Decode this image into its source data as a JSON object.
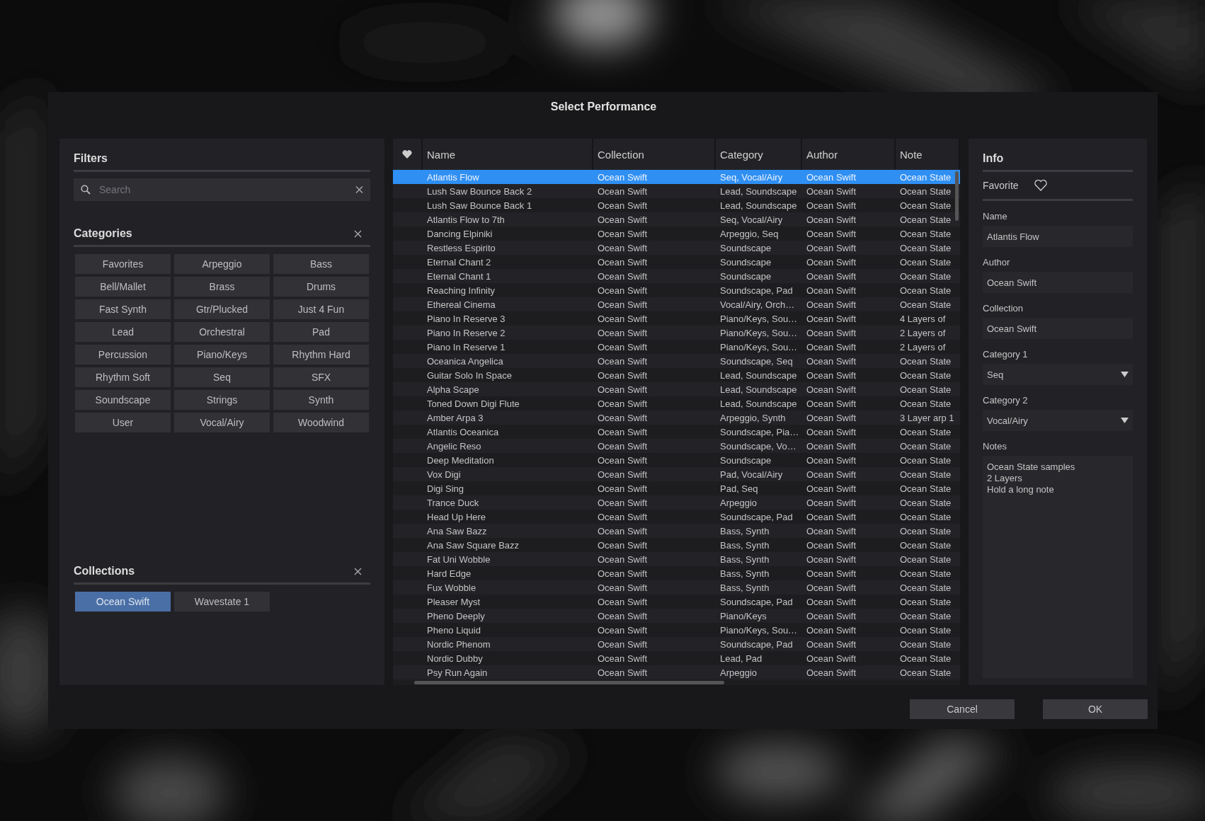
{
  "window": {
    "title": "Select Performance"
  },
  "filters": {
    "title": "Filters",
    "search": {
      "placeholder": "Search"
    }
  },
  "categories": {
    "title": "Categories",
    "items": [
      {
        "label": "Favorites",
        "selected": false
      },
      {
        "label": "Arpeggio",
        "selected": false
      },
      {
        "label": "Bass",
        "selected": false
      },
      {
        "label": "Bell/Mallet",
        "selected": false
      },
      {
        "label": "Brass",
        "selected": false
      },
      {
        "label": "Drums",
        "selected": false
      },
      {
        "label": "Fast Synth",
        "selected": false
      },
      {
        "label": "Gtr/Plucked",
        "selected": false
      },
      {
        "label": "Just 4 Fun",
        "selected": false
      },
      {
        "label": "Lead",
        "selected": false
      },
      {
        "label": "Orchestral",
        "selected": false
      },
      {
        "label": "Pad",
        "selected": false
      },
      {
        "label": "Percussion",
        "selected": false
      },
      {
        "label": "Piano/Keys",
        "selected": false
      },
      {
        "label": "Rhythm Hard",
        "selected": false
      },
      {
        "label": "Rhythm Soft",
        "selected": false
      },
      {
        "label": "Seq",
        "selected": false
      },
      {
        "label": "SFX",
        "selected": false
      },
      {
        "label": "Soundscape",
        "selected": false
      },
      {
        "label": "Strings",
        "selected": false
      },
      {
        "label": "Synth",
        "selected": false
      },
      {
        "label": "User",
        "selected": false
      },
      {
        "label": "Vocal/Airy",
        "selected": false
      },
      {
        "label": "Woodwind",
        "selected": false
      }
    ]
  },
  "collections": {
    "title": "Collections",
    "items": [
      {
        "label": "Ocean Swift",
        "selected": true
      },
      {
        "label": "Wavestate 1",
        "selected": false
      }
    ]
  },
  "table": {
    "columns": [
      "Name",
      "Collection",
      "Category",
      "Author",
      "Note"
    ],
    "rows": [
      {
        "name": "Atlantis Flow",
        "collection": "Ocean Swift",
        "category": "Seq, Vocal/Airy",
        "author": "Ocean Swift",
        "note": "Ocean State",
        "selected": true
      },
      {
        "name": "Lush Saw Bounce Back 2",
        "collection": "Ocean Swift",
        "category": "Lead, Soundscape",
        "author": "Ocean Swift",
        "note": "Ocean State",
        "selected": false
      },
      {
        "name": "Lush Saw Bounce Back 1",
        "collection": "Ocean Swift",
        "category": "Lead, Soundscape",
        "author": "Ocean Swift",
        "note": "Ocean State",
        "selected": false
      },
      {
        "name": "Atlantis Flow to 7th",
        "collection": "Ocean Swift",
        "category": "Seq, Vocal/Airy",
        "author": "Ocean Swift",
        "note": "Ocean State",
        "selected": false
      },
      {
        "name": "Dancing Elpiniki",
        "collection": "Ocean Swift",
        "category": "Arpeggio, Seq",
        "author": "Ocean Swift",
        "note": "Ocean State",
        "selected": false
      },
      {
        "name": "Restless Espirito",
        "collection": "Ocean Swift",
        "category": "Soundscape",
        "author": "Ocean Swift",
        "note": "Ocean State",
        "selected": false
      },
      {
        "name": "Eternal Chant 2",
        "collection": "Ocean Swift",
        "category": "Soundscape",
        "author": "Ocean Swift",
        "note": "Ocean State",
        "selected": false
      },
      {
        "name": "Eternal Chant 1",
        "collection": "Ocean Swift",
        "category": "Soundscape",
        "author": "Ocean Swift",
        "note": "Ocean State",
        "selected": false
      },
      {
        "name": "Reaching Infinity",
        "collection": "Ocean Swift",
        "category": "Soundscape, Pad",
        "author": "Ocean Swift",
        "note": "Ocean State",
        "selected": false
      },
      {
        "name": "Ethereal Cinema",
        "collection": "Ocean Swift",
        "category": "Vocal/Airy, Orch…",
        "author": "Ocean Swift",
        "note": "Ocean State",
        "selected": false
      },
      {
        "name": "Piano In Reserve 3",
        "collection": "Ocean Swift",
        "category": "Piano/Keys, Sou…",
        "author": "Ocean Swift",
        "note": "4 Layers of",
        "selected": false
      },
      {
        "name": "Piano In Reserve 2",
        "collection": "Ocean Swift",
        "category": "Piano/Keys, Sou…",
        "author": "Ocean Swift",
        "note": "2 Layers of",
        "selected": false
      },
      {
        "name": "Piano In Reserve 1",
        "collection": "Ocean Swift",
        "category": "Piano/Keys, Sou…",
        "author": "Ocean Swift",
        "note": "2 Layers of",
        "selected": false
      },
      {
        "name": "Oceanica Angelica",
        "collection": "Ocean Swift",
        "category": "Soundscape, Seq",
        "author": "Ocean Swift",
        "note": "Ocean State",
        "selected": false
      },
      {
        "name": "Guitar Solo In Space",
        "collection": "Ocean Swift",
        "category": "Lead, Soundscape",
        "author": "Ocean Swift",
        "note": "Ocean State",
        "selected": false
      },
      {
        "name": "Alpha Scape",
        "collection": "Ocean Swift",
        "category": "Lead, Soundscape",
        "author": "Ocean Swift",
        "note": "Ocean State",
        "selected": false
      },
      {
        "name": "Toned Down Digi Flute",
        "collection": "Ocean Swift",
        "category": "Lead, Soundscape",
        "author": "Ocean Swift",
        "note": "Ocean State",
        "selected": false
      },
      {
        "name": "Amber Arpa 3",
        "collection": "Ocean Swift",
        "category": "Arpeggio, Synth",
        "author": "Ocean Swift",
        "note": "3 Layer arp 1",
        "selected": false
      },
      {
        "name": "Atlantis Oceanica",
        "collection": "Ocean Swift",
        "category": "Soundscape, Pia…",
        "author": "Ocean Swift",
        "note": "Ocean State",
        "selected": false
      },
      {
        "name": "Angelic Reso",
        "collection": "Ocean Swift",
        "category": "Soundscape, Vo…",
        "author": "Ocean Swift",
        "note": "Ocean State",
        "selected": false
      },
      {
        "name": "Deep Meditation",
        "collection": "Ocean Swift",
        "category": "Soundscape",
        "author": "Ocean Swift",
        "note": "Ocean State",
        "selected": false
      },
      {
        "name": "Vox Digi",
        "collection": "Ocean Swift",
        "category": "Pad, Vocal/Airy",
        "author": "Ocean Swift",
        "note": "Ocean State",
        "selected": false
      },
      {
        "name": "Digi Sing",
        "collection": "Ocean Swift",
        "category": "Pad, Seq",
        "author": "Ocean Swift",
        "note": "Ocean State",
        "selected": false
      },
      {
        "name": "Trance Duck",
        "collection": "Ocean Swift",
        "category": "Arpeggio",
        "author": "Ocean Swift",
        "note": "Ocean State",
        "selected": false
      },
      {
        "name": "Head Up Here",
        "collection": "Ocean Swift",
        "category": "Soundscape, Pad",
        "author": "Ocean Swift",
        "note": "Ocean State",
        "selected": false
      },
      {
        "name": "Ana Saw Bazz",
        "collection": "Ocean Swift",
        "category": "Bass, Synth",
        "author": "Ocean Swift",
        "note": "Ocean State",
        "selected": false
      },
      {
        "name": "Ana Saw Square Bazz",
        "collection": "Ocean Swift",
        "category": "Bass, Synth",
        "author": "Ocean Swift",
        "note": "Ocean State",
        "selected": false
      },
      {
        "name": "Fat Uni Wobble",
        "collection": "Ocean Swift",
        "category": "Bass, Synth",
        "author": "Ocean Swift",
        "note": "Ocean State",
        "selected": false
      },
      {
        "name": "Hard Edge",
        "collection": "Ocean Swift",
        "category": "Bass, Synth",
        "author": "Ocean Swift",
        "note": "Ocean State",
        "selected": false
      },
      {
        "name": "Fux Wobble",
        "collection": "Ocean Swift",
        "category": "Bass, Synth",
        "author": "Ocean Swift",
        "note": "Ocean State",
        "selected": false
      },
      {
        "name": "Pleaser Myst",
        "collection": "Ocean Swift",
        "category": "Soundscape, Pad",
        "author": "Ocean Swift",
        "note": "Ocean State",
        "selected": false
      },
      {
        "name": "Pheno Deeply",
        "collection": "Ocean Swift",
        "category": "Piano/Keys",
        "author": "Ocean Swift",
        "note": "Ocean State",
        "selected": false
      },
      {
        "name": "Pheno Liquid",
        "collection": "Ocean Swift",
        "category": "Piano/Keys, Sou…",
        "author": "Ocean Swift",
        "note": "Ocean State",
        "selected": false
      },
      {
        "name": "Nordic Phenom",
        "collection": "Ocean Swift",
        "category": "Soundscape, Pad",
        "author": "Ocean Swift",
        "note": "Ocean State",
        "selected": false
      },
      {
        "name": "Nordic Dubby",
        "collection": "Ocean Swift",
        "category": "Lead, Pad",
        "author": "Ocean Swift",
        "note": "Ocean State",
        "selected": false
      },
      {
        "name": "Psy Run Again",
        "collection": "Ocean Swift",
        "category": "Arpeggio",
        "author": "Ocean Swift",
        "note": "Ocean State",
        "selected": false
      }
    ]
  },
  "info": {
    "title": "Info",
    "favorite": {
      "label": "Favorite",
      "on": false
    },
    "fields": [
      {
        "kind": "text",
        "label": "Name",
        "value": "Atlantis Flow"
      },
      {
        "kind": "text",
        "label": "Author",
        "value": "Ocean Swift"
      },
      {
        "kind": "text",
        "label": "Collection",
        "value": "Ocean Swift"
      },
      {
        "kind": "dropdown",
        "label": "Category 1",
        "value": "Seq"
      },
      {
        "kind": "dropdown",
        "label": "Category 2",
        "value": "Vocal/Airy"
      },
      {
        "kind": "notes",
        "label": "Notes",
        "value": "Ocean State samples\n2 Layers\nHold a long note"
      }
    ]
  },
  "buttons": [
    "Cancel",
    "OK"
  ]
}
